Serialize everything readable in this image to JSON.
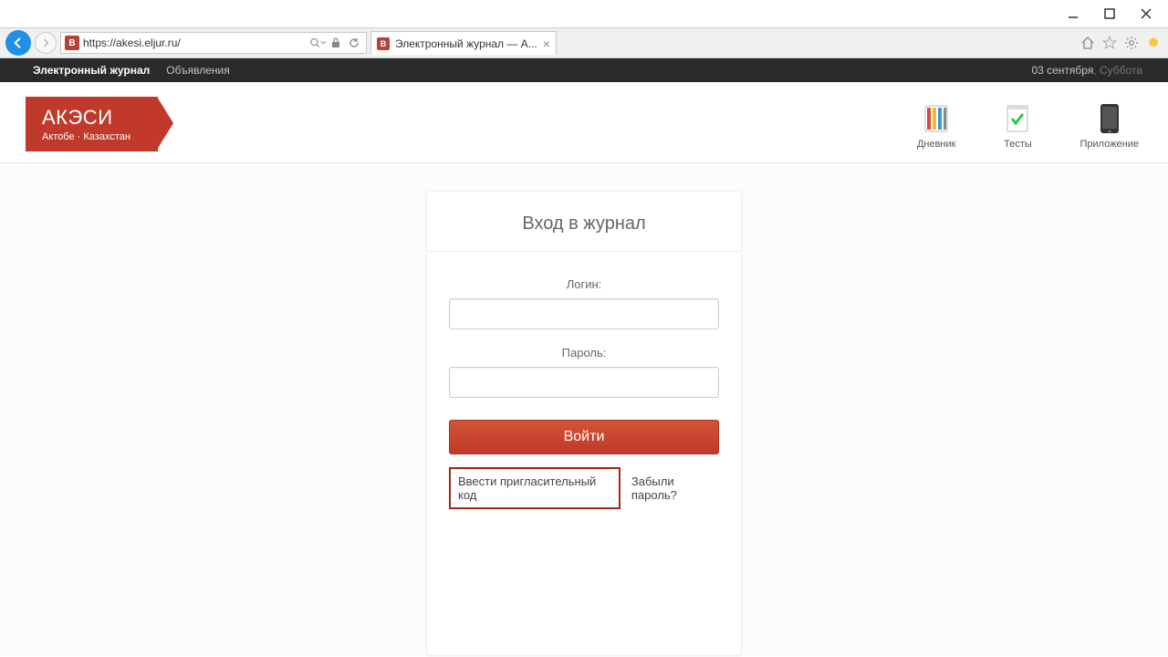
{
  "window": {
    "url": "https://akesi.eljur.ru/",
    "tab_title": "Электронный журнал — А..."
  },
  "darkbar": {
    "link1": "Электронный журнал",
    "link2": "Объявления",
    "date": "03 сентября",
    "day": ", Суббота"
  },
  "flag": {
    "title": "АКЭСИ",
    "sub": "Актобе · Казахстан"
  },
  "hdr_icons": {
    "diary": "Дневник",
    "tests": "Тесты",
    "app": "Приложение"
  },
  "login": {
    "title": "Вход в журнал",
    "login_label": "Логин:",
    "password_label": "Пароль:",
    "submit": "Войти",
    "invite": "Ввести пригласительный код",
    "forgot": "Забыли пароль?"
  }
}
